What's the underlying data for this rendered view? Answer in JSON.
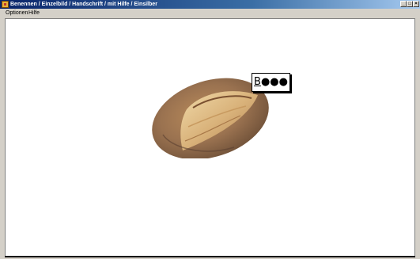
{
  "window": {
    "title": "Benennen / Einzelbild / Handschrift / mit Hilfe / Einsilber",
    "controls": {
      "minimize": "_",
      "maximize": "□",
      "close": "×"
    }
  },
  "menu": {
    "items": [
      {
        "label": "Optionen"
      },
      {
        "label": "Hilfe"
      }
    ]
  },
  "main": {
    "image": {
      "subject": "bread-loaf-icon"
    },
    "answer": {
      "first_letter": "B",
      "hint_dots": "●●●"
    }
  }
}
